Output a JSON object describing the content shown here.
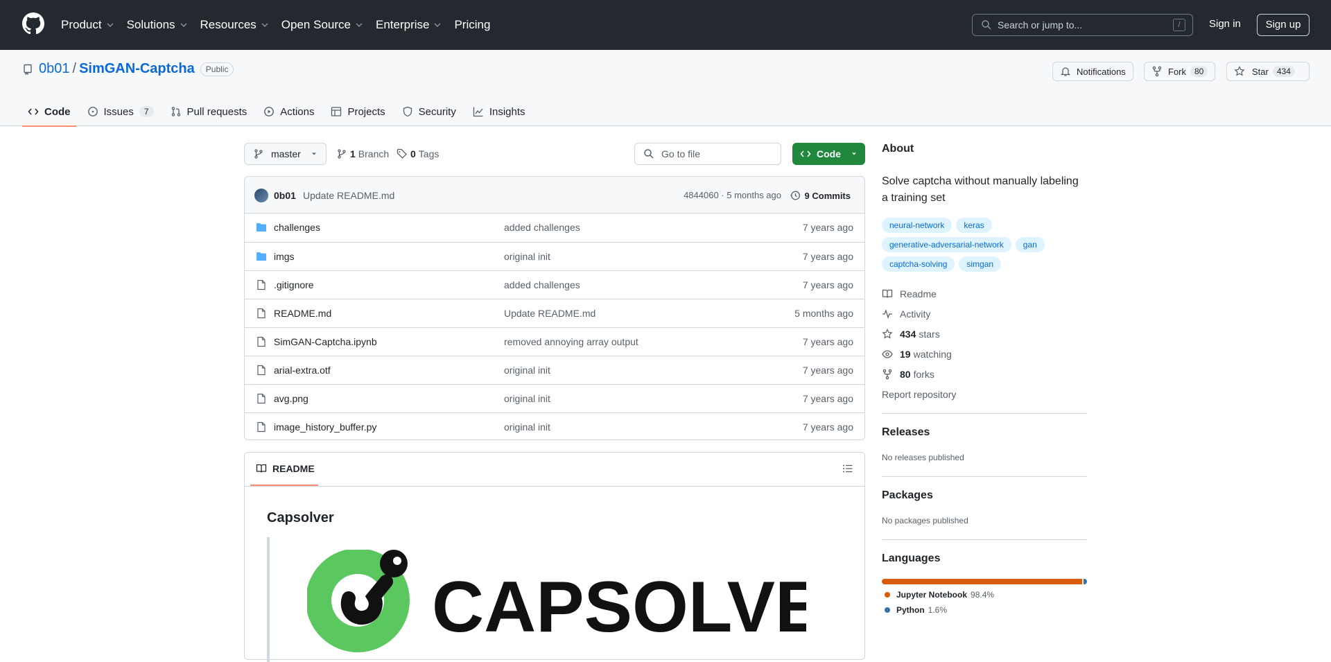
{
  "header": {
    "nav": [
      "Product",
      "Solutions",
      "Resources",
      "Open Source",
      "Enterprise",
      "Pricing"
    ],
    "search_placeholder": "Search or jump to...",
    "search_kbd": "/",
    "sign_in": "Sign in",
    "sign_up": "Sign up"
  },
  "repo": {
    "owner": "0b01",
    "separator": "/",
    "name": "SimGAN-Captcha",
    "visibility": "Public",
    "notifications": "Notifications",
    "fork_label": "Fork",
    "fork_count": "80",
    "star_label": "Star",
    "star_count": "434"
  },
  "tabs": {
    "code": "Code",
    "issues": "Issues",
    "issues_count": "7",
    "pulls": "Pull requests",
    "actions": "Actions",
    "projects": "Projects",
    "security": "Security",
    "insights": "Insights"
  },
  "toolbar": {
    "branch": "master",
    "branch_count": "1",
    "branch_label": "Branch",
    "tag_count": "0",
    "tag_label": "Tags",
    "go_to_file": "Go to file",
    "code_button": "Code"
  },
  "commit": {
    "author": "0b01",
    "message": "Update README.md",
    "sha_time": "4844060 · 5 months ago",
    "commits": "9 Commits"
  },
  "files": [
    {
      "type": "folder",
      "name": "challenges",
      "message": "added challenges",
      "age": "7 years ago"
    },
    {
      "type": "folder",
      "name": "imgs",
      "message": "original init",
      "age": "7 years ago"
    },
    {
      "type": "file",
      "name": ".gitignore",
      "message": "added challenges",
      "age": "7 years ago"
    },
    {
      "type": "file",
      "name": "README.md",
      "message": "Update README.md",
      "age": "5 months ago"
    },
    {
      "type": "file",
      "name": "SimGAN-Captcha.ipynb",
      "message": "removed annoying array output",
      "age": "7 years ago"
    },
    {
      "type": "file",
      "name": "arial-extra.otf",
      "message": "original init",
      "age": "7 years ago"
    },
    {
      "type": "file",
      "name": "avg.png",
      "message": "original init",
      "age": "7 years ago"
    },
    {
      "type": "file",
      "name": "image_history_buffer.py",
      "message": "original init",
      "age": "7 years ago"
    }
  ],
  "readme": {
    "tab": "README",
    "heading": "Capsolver",
    "logo_text": "CAPSOLVER"
  },
  "about": {
    "title": "About",
    "description": "Solve captcha without manually labeling a training set",
    "topics": [
      "neural-network",
      "keras",
      "generative-adversarial-network",
      "gan",
      "captcha-solving",
      "simgan"
    ],
    "readme": "Readme",
    "activity": "Activity",
    "stars_count": "434",
    "stars_label": "stars",
    "watching_count": "19",
    "watching_label": "watching",
    "forks_count": "80",
    "forks_label": "forks",
    "report": "Report repository"
  },
  "releases": {
    "title": "Releases",
    "text": "No releases published"
  },
  "packages": {
    "title": "Packages",
    "text": "No packages published"
  },
  "languages": {
    "title": "Languages",
    "items": [
      {
        "name": "Jupyter Notebook",
        "percent": "98.4%",
        "value": 98.4,
        "color": "#DA5B0B"
      },
      {
        "name": "Python",
        "percent": "1.6%",
        "value": 1.6,
        "color": "#3572A5"
      }
    ]
  },
  "colors": {
    "accent": "#0969da",
    "primary_button": "#1f883d",
    "header_bg": "#24292f",
    "tab_underline": "#fd8c73"
  }
}
